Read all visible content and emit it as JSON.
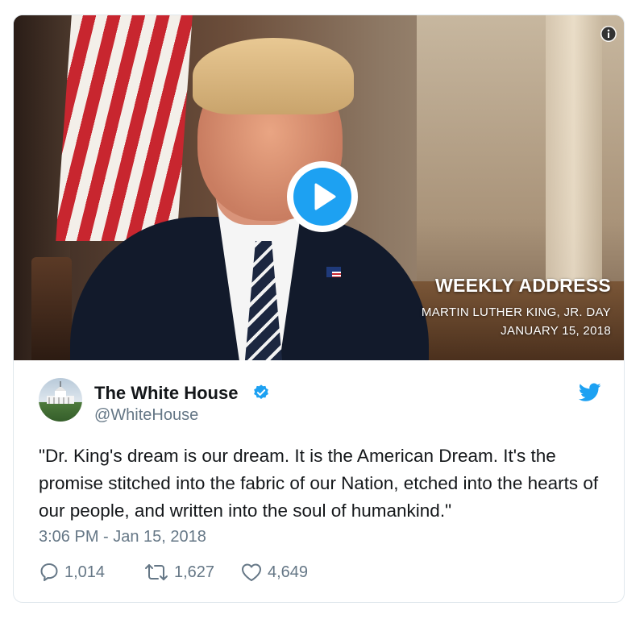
{
  "media": {
    "overlay_title": "WEEKLY ADDRESS",
    "overlay_subtitle": "MARTIN LUTHER KING, JR. DAY",
    "overlay_date": "JANUARY 15, 2018"
  },
  "author": {
    "name": "The White House",
    "handle": "@WhiteHouse",
    "verified": true
  },
  "tweet": {
    "text": "\"Dr. King's dream is our dream. It is the American Dream. It's the promise stitched into the fabric of our Nation, etched into the hearts of our people, and written into the soul of humankind.\"",
    "timestamp": "3:06 PM - Jan 15, 2018"
  },
  "stats": {
    "replies": "1,014",
    "retweets": "1,627",
    "likes": "4,649"
  },
  "colors": {
    "twitter_blue": "#1da1f2",
    "text_primary": "#14171a",
    "text_secondary": "#657786",
    "border": "#e1e8ed"
  },
  "icons": [
    "info-icon",
    "play-icon",
    "verified-badge-icon",
    "twitter-bird-icon",
    "reply-icon",
    "retweet-icon",
    "like-icon"
  ]
}
